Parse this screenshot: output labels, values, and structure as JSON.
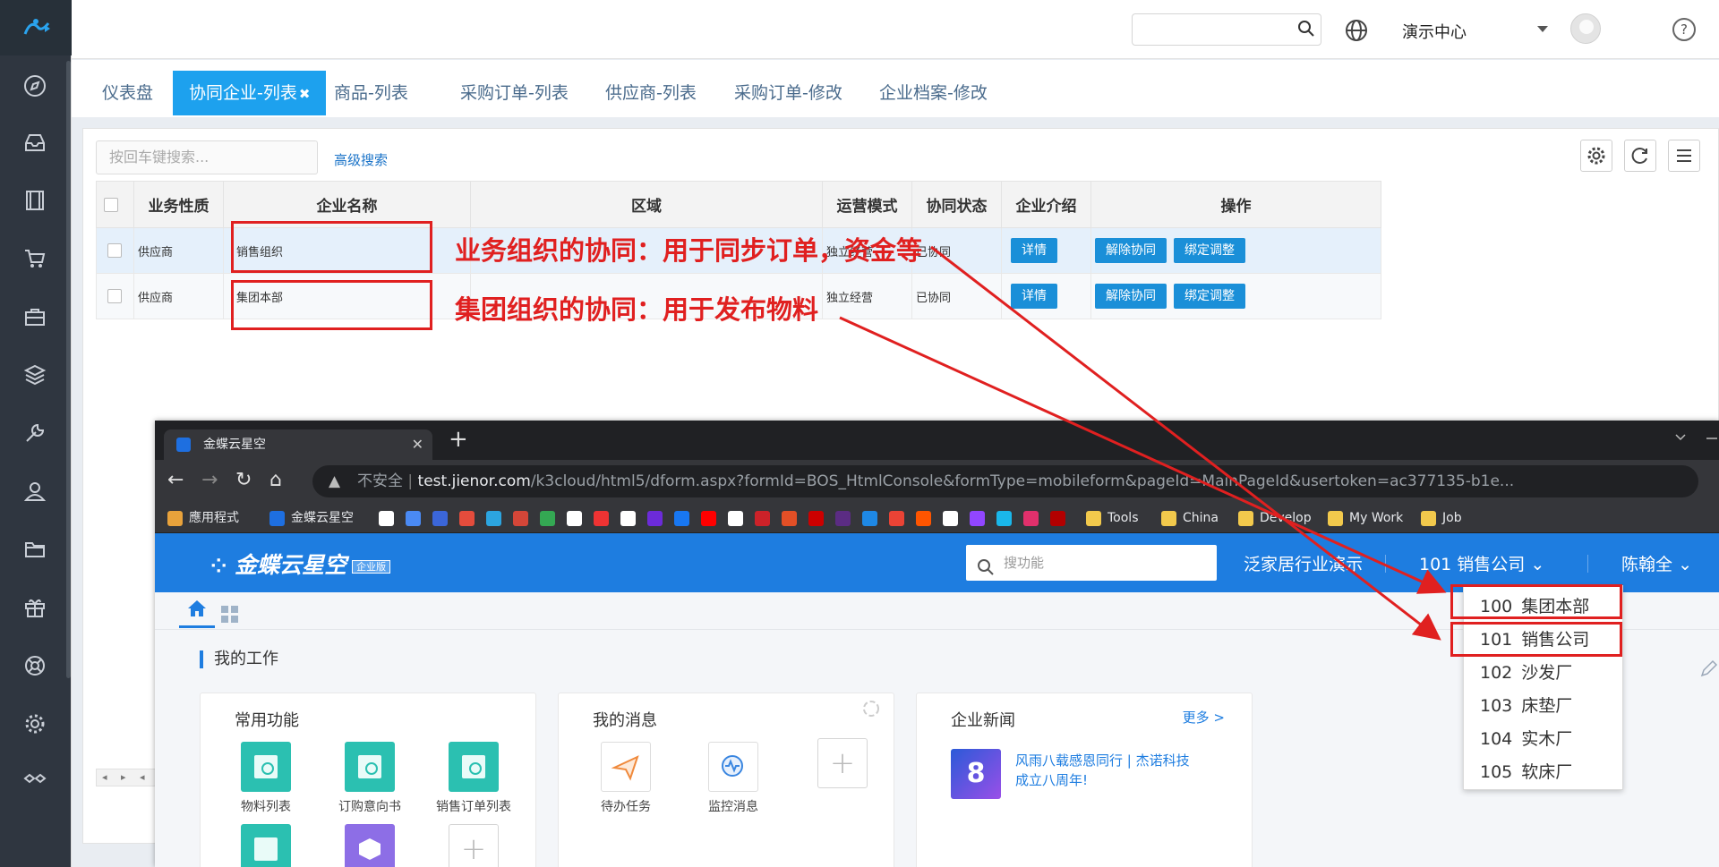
{
  "app": {
    "header_org": "演示中心",
    "header_search_placeholder": "",
    "tabs": [
      {
        "label": "仪表盘",
        "active": false
      },
      {
        "label": "协同企业-列表",
        "active": true,
        "close": "✖"
      },
      {
        "label": "商品-列表",
        "active": false
      },
      {
        "label": "采购订单-列表",
        "active": false
      },
      {
        "label": "供应商-列表",
        "active": false
      },
      {
        "label": "采购订单-修改",
        "active": false
      },
      {
        "label": "企业档案-修改",
        "active": false
      }
    ],
    "toolbar": {
      "search_placeholder": "按回车键搜索...",
      "advanced_search": "高级搜索"
    },
    "table": {
      "columns": [
        "业务性质",
        "企业名称",
        "区域",
        "运营模式",
        "协同状态",
        "企业介绍",
        "操作"
      ],
      "rows": [
        {
          "nature": "供应商",
          "name": "销售组织",
          "region": "",
          "mode": "独立经营",
          "status": "已协同",
          "intro_btn": "详情",
          "op1": "解除协同",
          "op2": "绑定调整"
        },
        {
          "nature": "供应商",
          "name": "集团本部",
          "region": "",
          "mode": "独立经营",
          "status": "已协同",
          "intro_btn": "详情",
          "op1": "解除协同",
          "op2": "绑定调整"
        }
      ],
      "hscroll": "◂ ▸ ◂"
    }
  },
  "annotations": {
    "a1": "业务组织的协同：用于同步订单，资金等",
    "a2": "集团组织的协同：用于发布物料"
  },
  "browser": {
    "tab_title": "金蝶云星空",
    "tab_close": "✕",
    "new_tab": "+",
    "insecure": "不安全",
    "url_host": "test.jienor.com",
    "url_path": "/k3cloud/html5/dform.aspx?formId=BOS_HtmlConsole&formType=mobileform&pageId=MainPageId&usertoken=ac377135-b1e...",
    "bookmarks": [
      {
        "label": "應用程式",
        "color": "#e8a23b"
      },
      {
        "label": "金蝶云星空",
        "color": "#1e6fe0"
      },
      {
        "label": "Tools",
        "color": "#f2c94c"
      },
      {
        "label": "China",
        "color": "#f2c94c"
      },
      {
        "label": "Develop",
        "color": "#f2c94c"
      },
      {
        "label": "My Work",
        "color": "#f2c94c"
      },
      {
        "label": "Job",
        "color": "#f2c94c"
      }
    ],
    "bookmark_icon_colors": [
      "#ffffff",
      "#4a8af4",
      "#3b66d9",
      "#e44c3c",
      "#2ca5e0",
      "#d44638",
      "#34a853",
      "#ffffff",
      "#e33",
      "#ffffff",
      "#6c2bd9",
      "#1877f2",
      "#ff0000",
      "#ffffff",
      "#cc2229",
      "#e34f26",
      "#cc0000",
      "#5b2c83",
      "#1e88e5",
      "#ea4335",
      "#ff5500",
      "#ffffff",
      "#9146ff",
      "#1ab7ea",
      "#e1306c",
      "#b20000"
    ]
  },
  "kingdee": {
    "logo": "金蝶云星空",
    "logo_tag": "企业版",
    "search_placeholder": "搜功能",
    "tenant": "泛家居行业演示",
    "org": "101 销售公司",
    "user": "陈翰全",
    "my_work": "我的工作",
    "cards": {
      "common": {
        "title": "常用功能",
        "items": [
          "物料列表",
          "订购意向书",
          "销售订单列表"
        ]
      },
      "messages": {
        "title": "我的消息",
        "items": [
          "待办任务",
          "监控消息"
        ]
      },
      "news": {
        "title": "企业新闻",
        "more": "更多 >",
        "headline": "风雨八载感恩同行 | 杰诺科技成立八周年!",
        "thumb": "8"
      }
    },
    "org_dropdown": [
      {
        "code": "100",
        "name": "集团本部"
      },
      {
        "code": "101",
        "name": "销售公司"
      },
      {
        "code": "102",
        "name": "沙发厂"
      },
      {
        "code": "103",
        "name": "床垫厂"
      },
      {
        "code": "104",
        "name": "实木厂"
      },
      {
        "code": "105",
        "name": "软床厂"
      }
    ]
  },
  "colors": {
    "accent": "#1da1ee",
    "annotation_red": "#e02020",
    "kingdee_blue": "#1e7de0",
    "sidebar": "#2f3640"
  }
}
